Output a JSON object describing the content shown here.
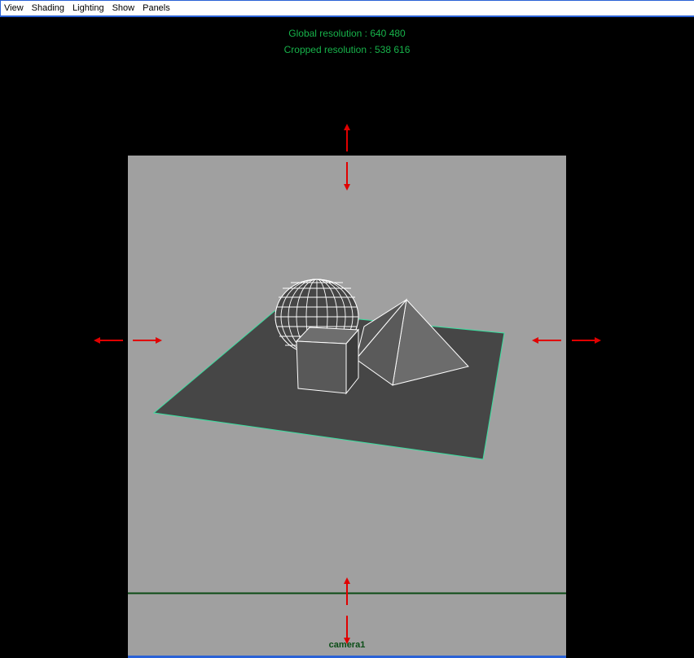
{
  "menu": {
    "items": [
      {
        "label": "View"
      },
      {
        "label": "Shading"
      },
      {
        "label": "Lighting"
      },
      {
        "label": "Show"
      },
      {
        "label": "Panels"
      }
    ]
  },
  "hud": {
    "global_resolution": "Global resolution : 640 480",
    "cropped_resolution": "Cropped resolution : 538 616"
  },
  "viewport": {
    "camera_name": "camera1",
    "background_color": "#a0a0a0",
    "plane_color": "#464646",
    "selection_color": "#39e0a0",
    "overlay_line_color": "#0b4a14",
    "arrow_color": "#e00000"
  }
}
